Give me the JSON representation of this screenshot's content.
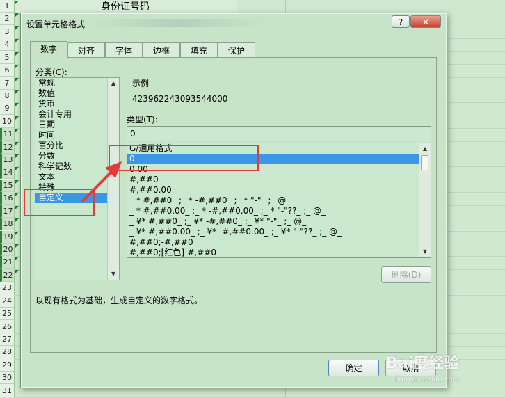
{
  "sheet": {
    "header_cell": "身份证号码",
    "row_numbers": [
      "1",
      "2",
      "3",
      "4",
      "5",
      "6",
      "7",
      "8",
      "9",
      "10",
      "11",
      "12",
      "13",
      "14",
      "15",
      "16",
      "17",
      "18",
      "19",
      "20",
      "21",
      "22",
      "23",
      "24",
      "25",
      "26",
      "27",
      "28",
      "29",
      "30",
      "31"
    ]
  },
  "dialog": {
    "title": "设置单元格格式",
    "help_label": "?",
    "close_label": "✕",
    "tabs": [
      {
        "label": "数字"
      },
      {
        "label": "对齐"
      },
      {
        "label": "字体"
      },
      {
        "label": "边框"
      },
      {
        "label": "填充"
      },
      {
        "label": "保护"
      }
    ],
    "category_label": "分类(C):",
    "categories": [
      "常规",
      "数值",
      "货币",
      "会计专用",
      "日期",
      "时间",
      "百分比",
      "分数",
      "科学记数",
      "文本",
      "特殊",
      "自定义"
    ],
    "selected_category": "自定义",
    "sample_label": "示例",
    "sample_value": "423962243093544000",
    "type_label": "类型(T):",
    "type_value": "0",
    "formats": [
      "G/通用格式",
      "0",
      "0.00",
      "#,##0",
      "#,##0.00",
      "_ * #,##0_ ;_ * -#,##0_ ;_ * \"-\"_ ;_ @_",
      "_ * #,##0.00_ ;_ * -#,##0.00_ ;_ * \"-\"??_ ;_ @_",
      "_ ¥* #,##0_ ;_ ¥* -#,##0_ ;_ ¥* \"-\"_ ;_ @_",
      "_ ¥* #,##0.00_ ;_ ¥* -#,##0.00_ ;_ ¥* \"-\"??_ ;_ @_",
      "#,##0;-#,##0",
      "#,##0;[红色]-#,##0"
    ],
    "selected_format": "0",
    "delete_label": "删除(D)",
    "description": "以现有格式为基础，生成自定义的数字格式。",
    "ok_label": "确定",
    "cancel_label": "取消"
  },
  "watermark": {
    "text": "Bai度经验",
    "sub": "jingyan.baidu.com"
  },
  "colors": {
    "selection": "#3c95e6",
    "annotation": "#e33b3b",
    "dialog_bg": "#c7e4c9"
  }
}
